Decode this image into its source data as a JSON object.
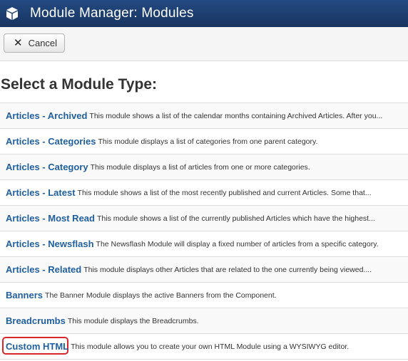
{
  "header": {
    "title": "Module Manager: Modules",
    "logo_icon": "joomla-cube-icon"
  },
  "toolbar": {
    "cancel_label": "Cancel"
  },
  "section_title": "Select a Module Type:",
  "modules": [
    {
      "name": "Articles - Archived",
      "description": "This module shows a list of the calendar months containing Archived Articles. After you..."
    },
    {
      "name": "Articles - Categories",
      "description": "This module displays a list of categories from one parent category."
    },
    {
      "name": "Articles - Category",
      "description": "This module displays a list of articles from one or more categories."
    },
    {
      "name": "Articles - Latest",
      "description": "This module shows a list of the most recently published and current Articles. Some that..."
    },
    {
      "name": "Articles - Most Read",
      "description": "This module shows a list of the currently published Articles which have the highest..."
    },
    {
      "name": "Articles - Newsflash",
      "description": "The Newsflash Module will display a fixed number of articles from a specific category."
    },
    {
      "name": "Articles - Related",
      "description": "This module displays other Articles that are related to the one currently being viewed...."
    },
    {
      "name": "Banners",
      "description": "The Banner Module displays the active Banners from the Component."
    },
    {
      "name": "Breadcrumbs",
      "description": "This module displays the Breadcrumbs."
    },
    {
      "name": "Custom HTML",
      "description": "This module allows you to create your own HTML Module using a WYSIWYG editor.",
      "highlighted": true
    }
  ],
  "colors": {
    "header_bg": "#1c3d6e",
    "link": "#1f5f9e",
    "highlight": "#d8262c"
  }
}
